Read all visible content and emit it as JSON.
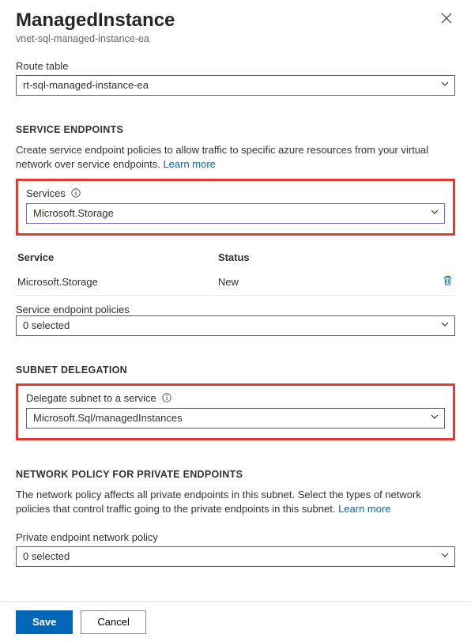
{
  "header": {
    "title": "ManagedInstance",
    "subtitle": "vnet-sql-managed-instance-ea"
  },
  "routeTable": {
    "label": "Route table",
    "value": "rt-sql-managed-instance-ea"
  },
  "serviceEndpoints": {
    "heading": "SERVICE ENDPOINTS",
    "desc": "Create service endpoint policies to allow traffic to specific azure resources from your virtual network over service endpoints. ",
    "learnMore": "Learn more",
    "servicesLabel": "Services",
    "servicesValue": "Microsoft.Storage",
    "table": {
      "colService": "Service",
      "colStatus": "Status",
      "rowService": "Microsoft.Storage",
      "rowStatus": "New"
    },
    "policiesLabel": "Service endpoint policies",
    "policiesValue": "0 selected"
  },
  "subnetDelegation": {
    "heading": "SUBNET DELEGATION",
    "label": "Delegate subnet to a service",
    "value": "Microsoft.Sql/managedInstances"
  },
  "networkPolicy": {
    "heading": "NETWORK POLICY FOR PRIVATE ENDPOINTS",
    "desc": "The network policy affects all private endpoints in this subnet. Select the types of network policies that control traffic going to the private endpoints in this subnet. ",
    "learnMore": "Learn more",
    "label": "Private endpoint network policy",
    "value": "0 selected"
  },
  "footer": {
    "save": "Save",
    "cancel": "Cancel"
  }
}
